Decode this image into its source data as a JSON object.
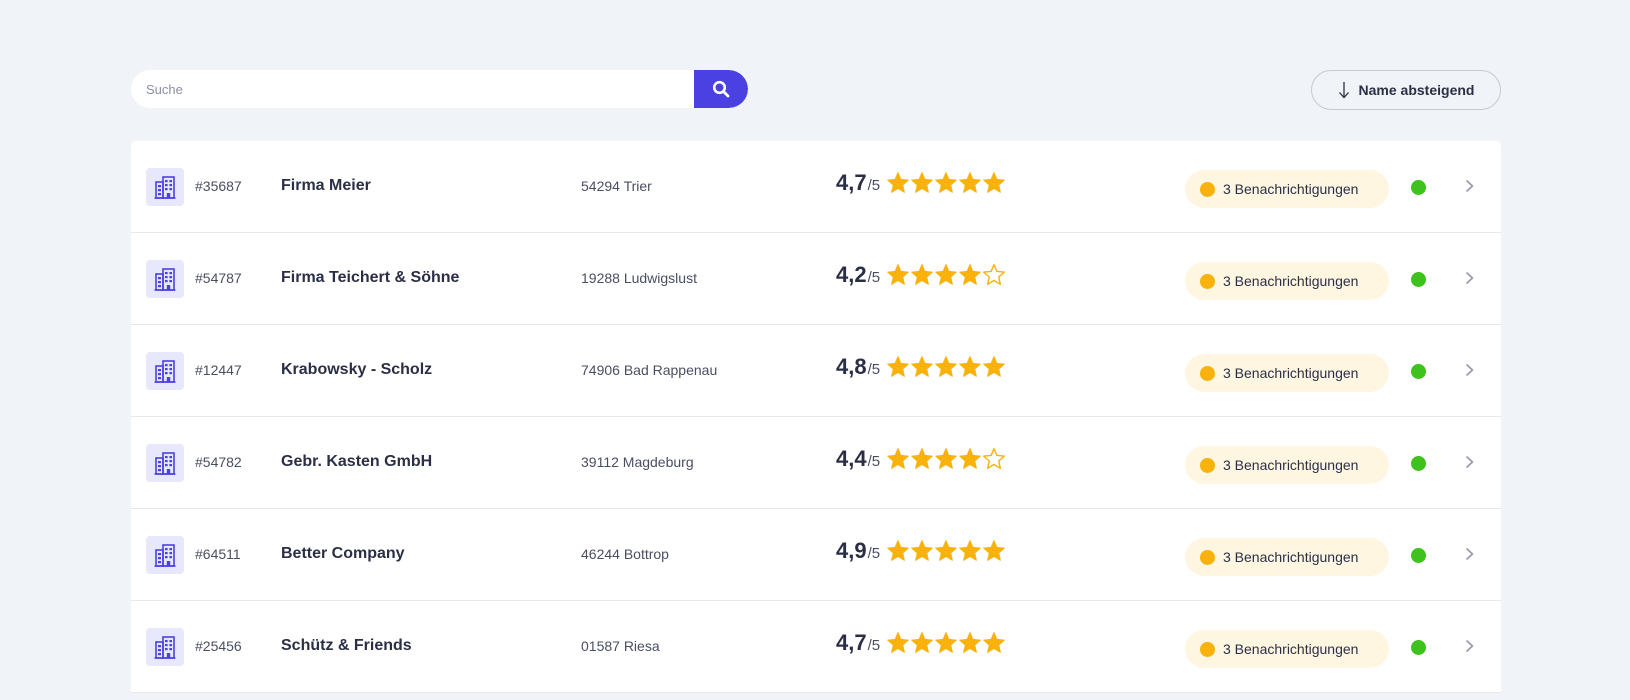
{
  "search": {
    "placeholder": "Suche",
    "value": ""
  },
  "sort": {
    "label": "Name absteigend"
  },
  "colors": {
    "accent": "#4b41e3",
    "star": "#f9b10c",
    "badge_bg": "#fef6e1",
    "status_active": "#3fc21e"
  },
  "companies": [
    {
      "id": "#35687",
      "name": "Firma Meier",
      "location": "54294 Trier",
      "rating": "4,7",
      "rating_max": "/5",
      "stars_filled": 5,
      "notifications": "3 Benachrichtigungen",
      "status": "active"
    },
    {
      "id": "#54787",
      "name": "Firma Teichert & Söhne",
      "location": "19288 Ludwigslust",
      "rating": "4,2",
      "rating_max": "/5",
      "stars_filled": 4,
      "notifications": "3 Benachrichtigungen",
      "status": "active"
    },
    {
      "id": "#12447",
      "name": "Krabowsky - Scholz",
      "location": "74906 Bad Rappenau",
      "rating": "4,8",
      "rating_max": "/5",
      "stars_filled": 5,
      "notifications": "3 Benachrichtigungen",
      "status": "active"
    },
    {
      "id": "#54782",
      "name": "Gebr. Kasten GmbH",
      "location": "39112 Magdeburg",
      "rating": "4,4",
      "rating_max": "/5",
      "stars_filled": 4,
      "notifications": "3 Benachrichtigungen",
      "status": "active"
    },
    {
      "id": "#64511",
      "name": "Better Company",
      "location": "46244 Bottrop",
      "rating": "4,9",
      "rating_max": "/5",
      "stars_filled": 5,
      "notifications": "3 Benachrichtigungen",
      "status": "active"
    },
    {
      "id": "#25456",
      "name": "Schütz & Friends",
      "location": "01587 Riesa",
      "rating": "4,7",
      "rating_max": "/5",
      "stars_filled": 5,
      "notifications": "3 Benachrichtigungen",
      "status": "active"
    }
  ]
}
